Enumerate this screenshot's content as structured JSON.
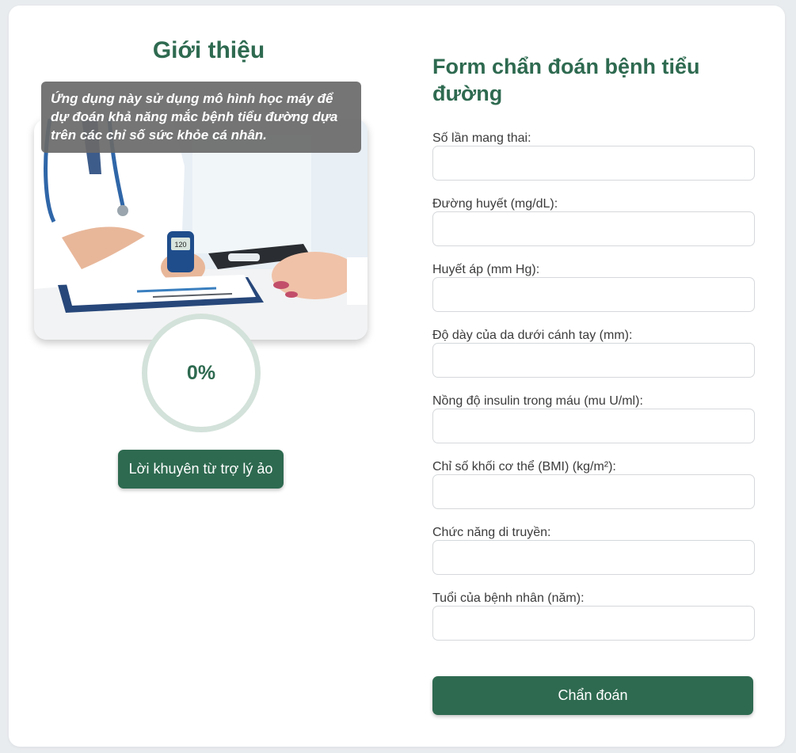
{
  "intro": {
    "title": "Giới thiệu",
    "description": "Ứng dụng này sử dụng mô hình học máy để dự đoán khả năng mắc bệnh tiểu đường dựa trên các chỉ số sức khỏe cá nhân.",
    "photo_glucometer_reading": "120",
    "progress": "0%",
    "progress_fraction": 0,
    "advice_button": "Lời khuyên từ trợ lý ảo"
  },
  "form": {
    "title": "Form chẩn đoán bệnh tiểu đường",
    "fields": [
      {
        "label": "Số lần mang thai:",
        "value": ""
      },
      {
        "label": "Đường huyết (mg/dL):",
        "value": ""
      },
      {
        "label": "Huyết áp (mm Hg):",
        "value": ""
      },
      {
        "label": "Độ dày của da dưới cánh tay (mm):",
        "value": ""
      },
      {
        "label": "Nồng độ insulin trong máu (mu U/ml):",
        "value": ""
      },
      {
        "label": "Chỉ số khối cơ thể (BMI) (kg/m²):",
        "value": ""
      },
      {
        "label": "Chức năng di truyền:",
        "value": ""
      },
      {
        "label": "Tuổi của bệnh nhân (năm):",
        "value": ""
      }
    ],
    "submit_button": "Chẩn đoán"
  },
  "colors": {
    "accent": "#2e6a50",
    "page_bg": "#e9ecef",
    "card_bg": "#ffffff",
    "progress_ring": "#d3e2da"
  }
}
